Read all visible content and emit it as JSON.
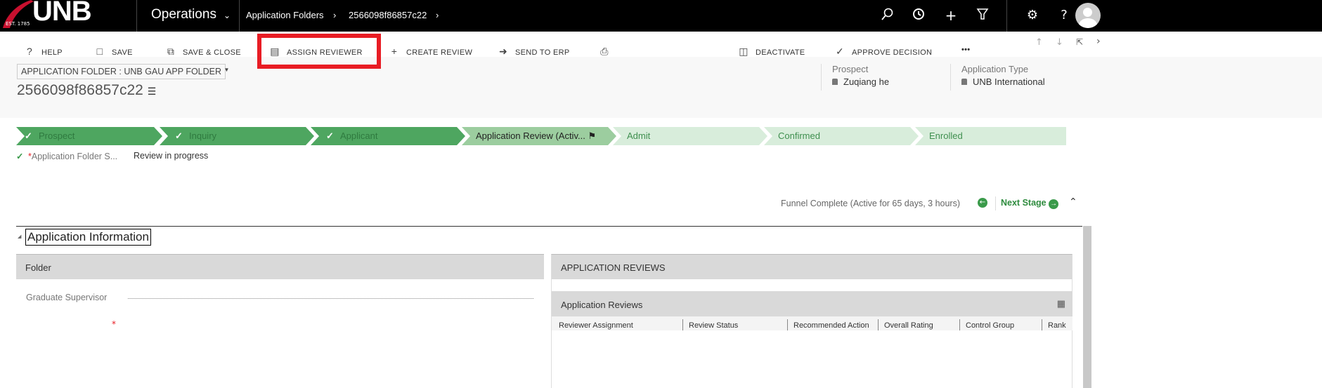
{
  "topbar": {
    "logo_text": "UNB",
    "logo_est": "EST. 1785",
    "app": "Operations",
    "breadcrumb": [
      "Application Folders",
      "2566098f86857c22"
    ],
    "icons": [
      "search-icon",
      "history-icon",
      "plus-icon",
      "filter-icon",
      "gear-icon",
      "help-icon",
      "avatar"
    ]
  },
  "commands": [
    {
      "label": "HELP",
      "icon": "help-icon"
    },
    {
      "label": "SAVE",
      "icon": "save-icon"
    },
    {
      "label": "SAVE & CLOSE",
      "icon": "save-close-icon"
    },
    {
      "label": "ASSIGN REVIEWER",
      "icon": "assign-icon"
    },
    {
      "label": "CREATE REVIEW",
      "icon": "plus-icon"
    },
    {
      "label": "SEND TO ERP",
      "icon": "send-icon"
    },
    {
      "label": "",
      "icon": "print-icon"
    },
    {
      "label": "DEACTIVATE",
      "icon": "deactivate-icon"
    },
    {
      "label": "APPROVE DECISION",
      "icon": "check-icon"
    },
    {
      "label": "•••",
      "icon": "more-icon"
    }
  ],
  "header": {
    "form_selector": "APPLICATION FOLDER : UNB GAU APP FOLDER",
    "record_title": "2566098f86857c22",
    "fields": [
      {
        "label": "Prospect",
        "value": "Zuqiang he"
      },
      {
        "label": "Application Type",
        "value": "UNB International"
      }
    ]
  },
  "process": {
    "stages": [
      {
        "label": "Prospect",
        "state": "done"
      },
      {
        "label": "Inquiry",
        "state": "done"
      },
      {
        "label": "Applicant",
        "state": "done"
      },
      {
        "label": "Application Review (Activ...",
        "state": "active"
      },
      {
        "label": "Admit",
        "state": "future"
      },
      {
        "label": "Confirmed",
        "state": "future"
      },
      {
        "label": "Enrolled",
        "state": "future"
      }
    ],
    "step_label": "Application Folder S...",
    "step_value": "Review in progress",
    "funnel": "Funnel Complete (Active for 65 days, 3 hours)",
    "next_stage": "Next Stage"
  },
  "section": {
    "title": "Application Information",
    "folder_header": "Folder",
    "graduate_supervisor": "Graduate Supervisor",
    "reviews_header": "APPLICATION REVIEWS",
    "subgrid_title": "Application Reviews",
    "columns": [
      "Reviewer Assignment",
      "Review Status",
      "Recommended Action",
      "Overall Rating",
      "Control Group",
      "Rank"
    ]
  },
  "colors": {
    "accent": "#4ea660",
    "highlight": "#e81c24"
  }
}
